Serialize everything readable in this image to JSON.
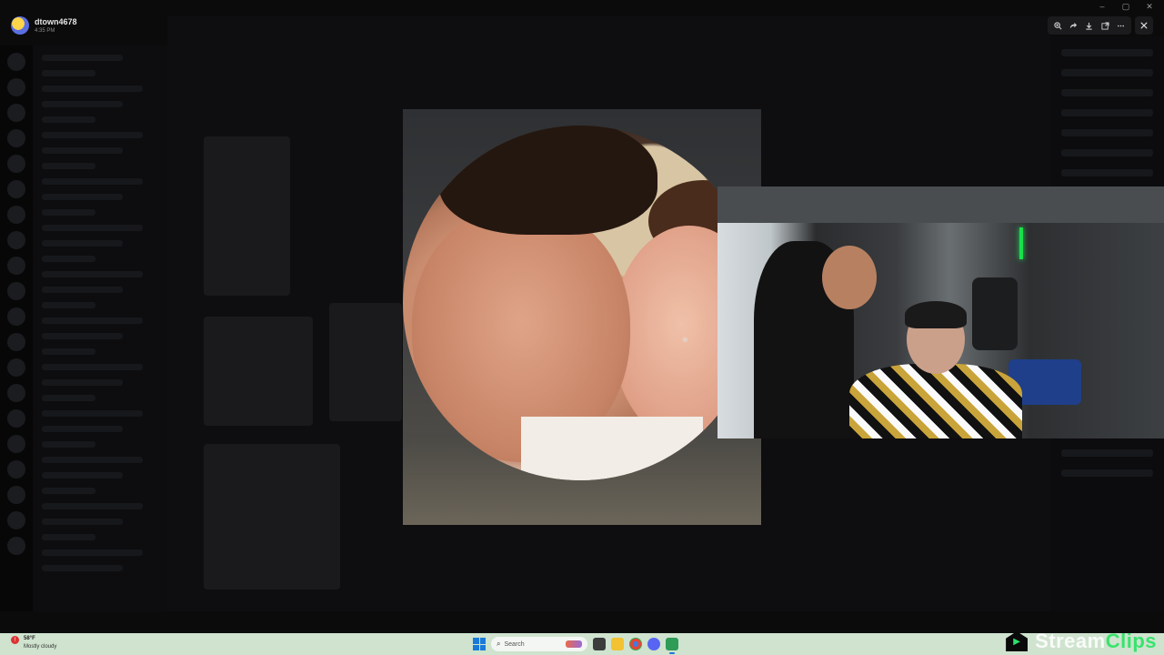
{
  "viewer": {
    "username": "dtown4678",
    "timestamp": "4:35 PM"
  },
  "toolbar": {
    "zoom_icon": "zoom-in-icon",
    "forward_icon": "forward-icon",
    "download_icon": "download-icon",
    "open_icon": "open-in-browser-icon",
    "more_icon": "more-icon",
    "close_icon": "close-icon"
  },
  "window_controls": [
    "–",
    "▢",
    "✕"
  ],
  "taskbar": {
    "weather_temp": "58°F",
    "weather_condition": "Mostly cloudy",
    "search_label": "Search"
  },
  "watermark": {
    "text_main": "Stream",
    "text_accent": "Clips"
  },
  "colors": {
    "taskbar_bg": "#cfe3cf",
    "accent": "#39e36e",
    "start_blue": "#1a7ad9"
  }
}
